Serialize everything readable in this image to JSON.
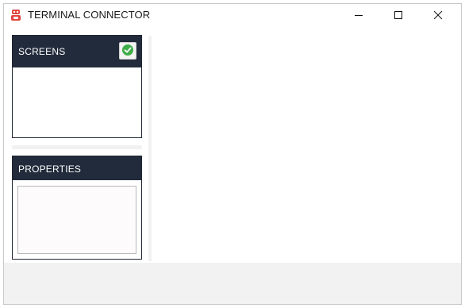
{
  "window": {
    "title": "TERMINAL CONNECTOR",
    "icon": "robot-icon",
    "controls": [
      "minimize-icon",
      "maximize-icon",
      "close-icon"
    ]
  },
  "screens_panel": {
    "title": "SCREENS",
    "action_icon": "check-icon",
    "items": []
  },
  "properties_panel": {
    "title": "PROPERTIES",
    "fields": []
  },
  "colors": {
    "panel_header_bg": "#222b3b",
    "panel_header_text": "#ffffff",
    "app_icon": "#e0443f",
    "check_green": "#3fae49",
    "status_bar_bg": "#f2f2f2"
  }
}
